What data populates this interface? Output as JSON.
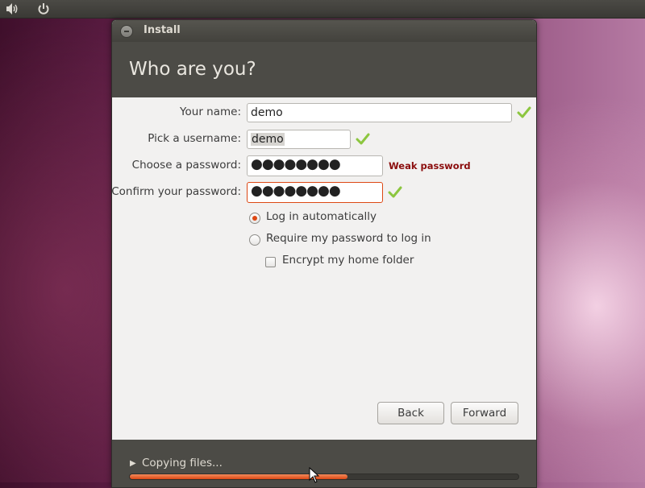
{
  "panel": {
    "icons": [
      "volume-icon",
      "power-icon"
    ]
  },
  "window": {
    "title": "Install",
    "heading": "Who are you?"
  },
  "form": {
    "name_label": "Your name:",
    "name_value": "demo",
    "username_label": "Pick a username:",
    "username_value": "demo",
    "password_label": "Choose a password:",
    "password_mask": "●●●●●●●●",
    "password_strength": "Weak password",
    "confirm_label": "Confirm your password:",
    "confirm_mask": "●●●●●●●●",
    "login_auto_label": "Log in automatically",
    "login_auto_selected": true,
    "require_password_label": "Require my password to log in",
    "require_password_selected": false,
    "encrypt_label": "Encrypt my home folder",
    "encrypt_checked": false
  },
  "buttons": {
    "back": "Back",
    "forward": "Forward"
  },
  "footer": {
    "status": "Copying files...",
    "progress": 0.56
  },
  "colors": {
    "accent": "#dd4814",
    "valid_check": "#8cc63f",
    "weak_text": "#8b0d0d"
  }
}
